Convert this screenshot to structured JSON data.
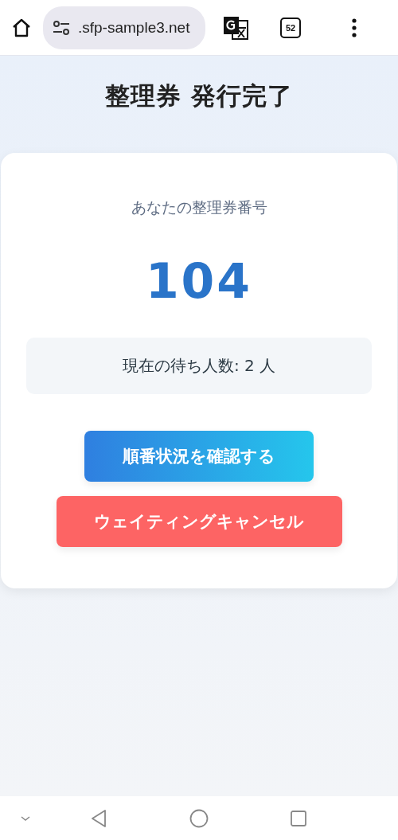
{
  "browser": {
    "url": ".sfp-sample3.net",
    "tab_count": "52"
  },
  "title": "整理券 発行完了",
  "ticket": {
    "label": "あなたの整理券番号",
    "number": "104",
    "waiting": "現在の待ち人数: 2 人"
  },
  "buttons": [
    {
      "label": "順番状況を確認する",
      "kind": "primary"
    },
    {
      "label": "ウェイティングキャンセル",
      "kind": "danger"
    }
  ]
}
